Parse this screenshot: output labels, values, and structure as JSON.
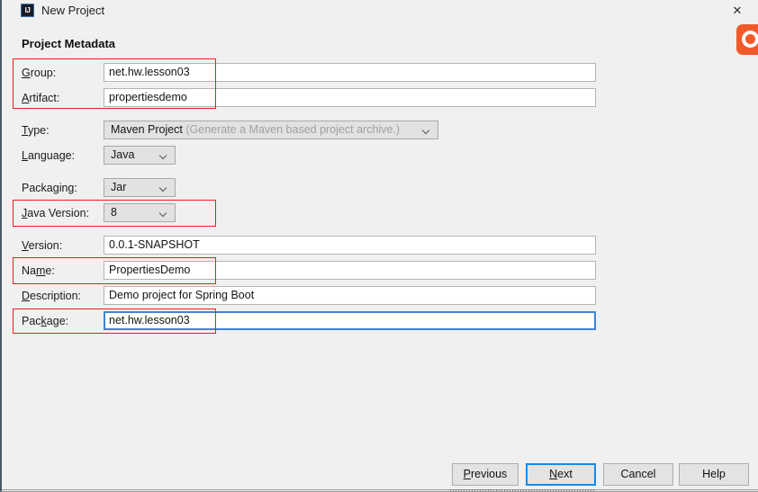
{
  "window": {
    "title": "New Project",
    "app_icon": "IJ",
    "close_icon": "✕",
    "accent_focus_color": "#1589e4",
    "annotation_color": "#ee1c1c"
  },
  "content": {
    "section_heading": "Project Metadata"
  },
  "fields": {
    "group": {
      "label_pre": "",
      "label_accel": "G",
      "label_post": "roup:",
      "value": "net.hw.lesson03",
      "highlighted": true
    },
    "artifact": {
      "label_pre": "",
      "label_accel": "A",
      "label_post": "rtifact:",
      "value": "propertiesdemo",
      "highlighted": true
    },
    "type": {
      "label_pre": "",
      "label_accel": "T",
      "label_post": "ype:",
      "value": "Maven Project",
      "hint": "(Generate a Maven based project archive.)"
    },
    "language": {
      "label_pre": "",
      "label_accel": "L",
      "label_post": "anguage:",
      "value": "Java"
    },
    "packaging": {
      "label_pre": "Packa",
      "label_accel": "g",
      "label_post": "ing:",
      "value": "Jar"
    },
    "java_version": {
      "label_pre": "",
      "label_accel": "J",
      "label_post": "ava Version:",
      "value": "8",
      "highlighted": true
    },
    "version": {
      "label_pre": "",
      "label_accel": "V",
      "label_post": "ersion:",
      "value": "0.0.1-SNAPSHOT"
    },
    "name": {
      "label_pre": "Na",
      "label_accel": "m",
      "label_post": "e:",
      "value": "PropertiesDemo",
      "highlighted": true
    },
    "description": {
      "label_pre": "",
      "label_accel": "D",
      "label_post": "escription:",
      "value": "Demo project for Spring Boot"
    },
    "package": {
      "label_pre": "Pac",
      "label_accel": "k",
      "label_post": "age:",
      "value": "net.hw.lesson03",
      "focused": true,
      "highlighted": true
    }
  },
  "buttons": {
    "previous": {
      "pre": "",
      "accel": "P",
      "post": "revious"
    },
    "next": {
      "pre": "",
      "accel": "N",
      "post": "ext",
      "is_default": true
    },
    "cancel": {
      "pre": "Cancel",
      "accel": "",
      "post": ""
    },
    "help": {
      "pre": "Help",
      "accel": "",
      "post": ""
    }
  }
}
